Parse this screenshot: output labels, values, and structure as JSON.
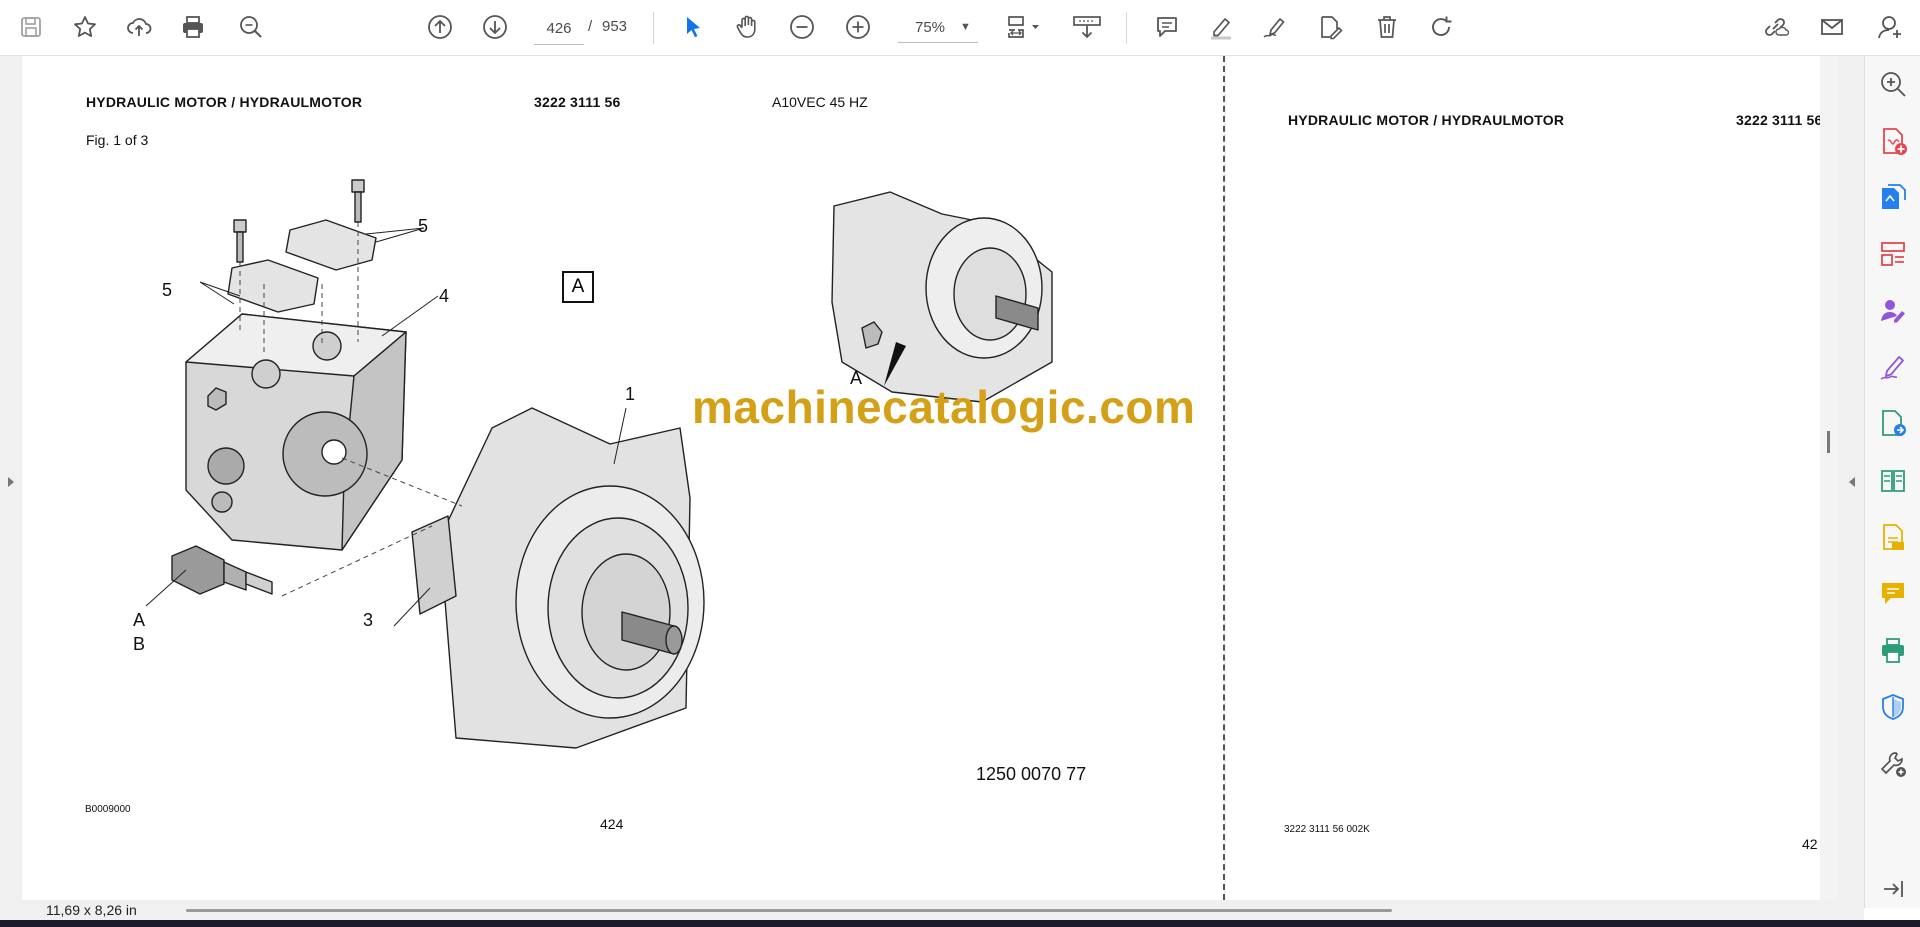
{
  "toolbar": {
    "page_current": "426",
    "page_separator": "/",
    "page_total": "953",
    "zoom": "75%"
  },
  "document": {
    "left_page": {
      "header_title": "HYDRAULIC MOTOR / HYDRAULMOTOR",
      "header_part_no": "3222 3111 56",
      "header_model": "A10VEC 45 HZ",
      "fig_label": "Fig. 1 of 3",
      "callout_a_box": "A",
      "callout_1": "1",
      "callout_3": "3",
      "callout_4": "4",
      "callout_5_top": "5",
      "callout_5_left": "5",
      "label_a": "A",
      "label_b": "B",
      "label_a_small": "A",
      "part_number_bottom": "1250 0070 77",
      "footer_code": "B0009000",
      "page_number": "424"
    },
    "right_page": {
      "header_title": "HYDRAULIC MOTOR / HYDRAULMOTOR",
      "header_part_no": "3222 3111 56",
      "footer_code": "3222 3111 56  002K",
      "page_number": "42"
    },
    "watermark": "machinecatalogic.com"
  },
  "status": {
    "page_size": "11,69 x 8,26 in"
  },
  "colors": {
    "accent_blue": "#1473e6",
    "watermark": "#d4a017",
    "rail_red": "#e34850",
    "rail_blue": "#2680eb",
    "rail_purple": "#9256d9",
    "rail_yellow": "#e8b100",
    "rail_green": "#2d9d78"
  }
}
